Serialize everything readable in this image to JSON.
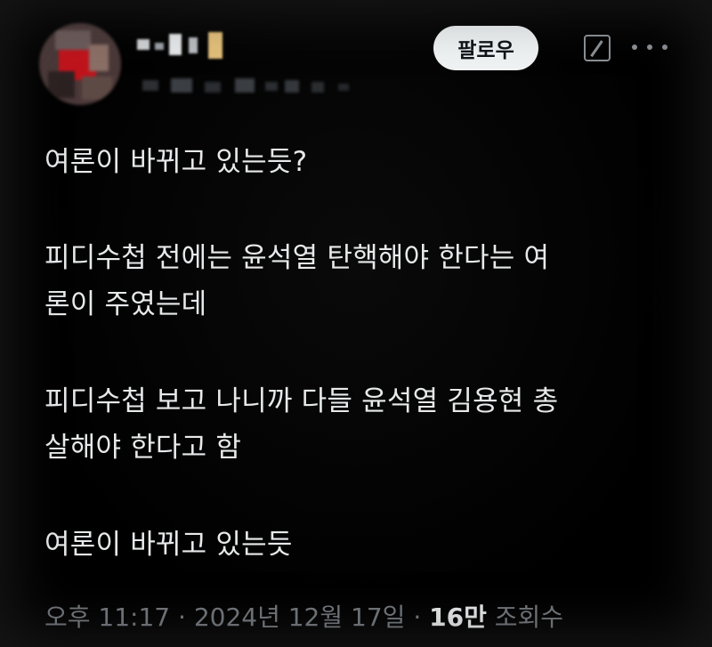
{
  "header": {
    "follow_label": "팔로우",
    "grok_icon": "slash-square-icon",
    "more_icon": "more-dots-icon"
  },
  "tweet": {
    "lines": [
      "여론이 바뀌고 있는듯?",
      "피디수첩 전에는 윤석열 탄핵해야 한다는 여",
      "론이 주였는데",
      "피디수첩 보고 나니까 다들 윤석열 김용현 총",
      "살해야 한다고 함",
      "여론이 바뀌고 있는듯"
    ]
  },
  "meta": {
    "time": "오후 11:17",
    "sep1": " · ",
    "date": "2024년 12월 17일",
    "sep2": " · ",
    "views_count": "16만",
    "views_label": " 조회수"
  },
  "colors": {
    "background": "#000000",
    "text": "#e7e9ea",
    "muted": "#71767b",
    "button_bg": "#eff3f4"
  }
}
